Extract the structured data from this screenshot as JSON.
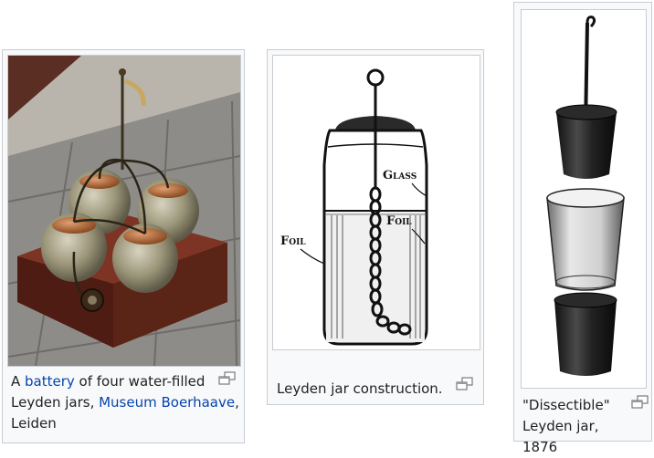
{
  "figures": [
    {
      "caption_parts": [
        "A ",
        "battery",
        " of four water-filled Leyden jars, ",
        "Museum Boerhaave",
        ", Leiden"
      ],
      "enlarge_icon": "magnify-clip-icon"
    },
    {
      "caption": "Leyden jar construction.",
      "labels": {
        "glass": "Glass",
        "foil_right": "Foil",
        "foil_left": "Foil"
      },
      "enlarge_icon": "magnify-clip-icon"
    },
    {
      "caption": "\"Dissectible\" Leyden jar, 1876",
      "enlarge_icon": "magnify-clip-icon"
    }
  ],
  "colors": {
    "link": "#0645ad",
    "frame_border": "#c8ccd1",
    "frame_bg": "#f8f9fa"
  }
}
